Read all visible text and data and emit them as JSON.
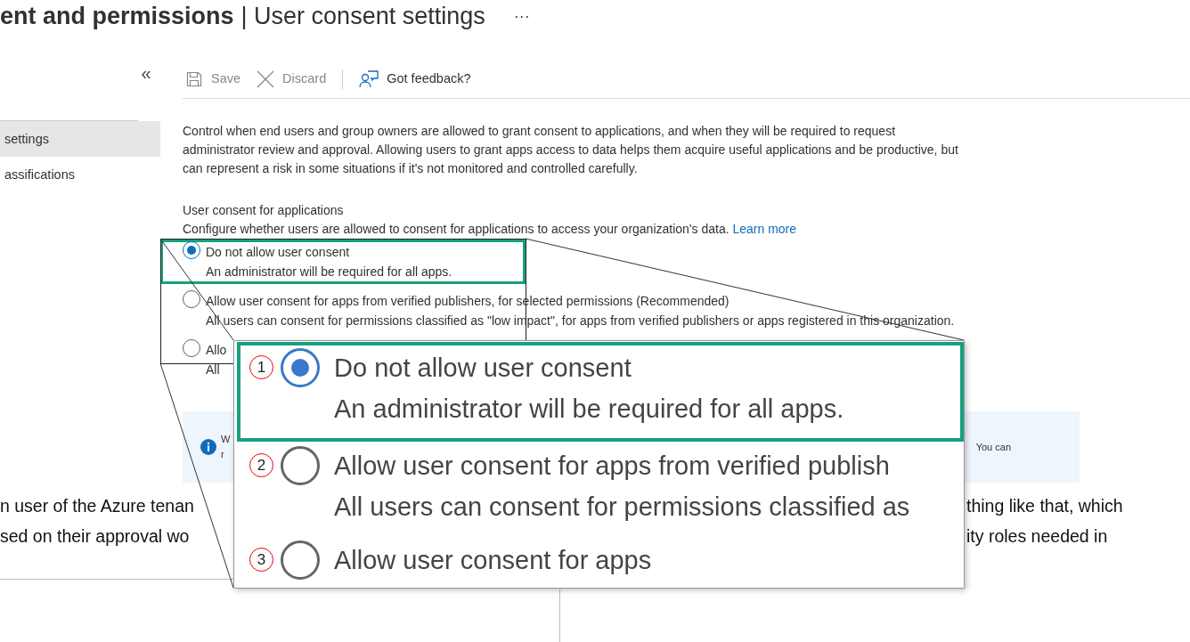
{
  "header": {
    "title_bold": "ent and permissions",
    "title_rest": "| User consent settings",
    "more": "···"
  },
  "sidebar": {
    "collapse": "«",
    "items": [
      {
        "label": "settings",
        "selected": true
      },
      {
        "label": "assifications",
        "selected": false
      }
    ]
  },
  "toolbar": [
    {
      "kind": "save",
      "label": "Save",
      "disabled": true
    },
    {
      "kind": "discard",
      "label": "Discard",
      "disabled": true
    },
    {
      "kind": "feedback",
      "label": "Got feedback?",
      "disabled": false
    }
  ],
  "description": "Control when end users and group owners are allowed to grant consent to applications, and when they will be required to request\nadministrator review and approval. Allowing users to grant apps access to data helps them acquire useful applications and be productive, but\ncan represent a risk in some situations if it's not monitored and controlled carefully.",
  "section": {
    "title": "User consent for applications",
    "hint": "Configure whether users are allowed to consent for applications to access your organization's data.",
    "link": "Learn more"
  },
  "options": [
    {
      "label": "Do not allow user consent",
      "description": "An administrator will be required for all apps.",
      "selected": true,
      "highlighted": true
    },
    {
      "label": "Allow user consent for apps from verified publishers, for selected permissions (Recommended)",
      "description": "All users can consent for permissions classified as \"low impact\", for apps from verified publishers or apps registered in this organization.",
      "selected": false
    },
    {
      "label": "Allo",
      "description": "All",
      "selected": false
    }
  ],
  "info": {
    "fragments": [
      "W",
      "r"
    ],
    "right_text": "You can"
  },
  "document_lines": [
    {
      "left": "n user of the Azure tenan",
      "right": "thing like that, which"
    },
    {
      "left": "sed on their approval wo",
      "right": "ity roles needed in"
    }
  ],
  "callout": {
    "items": [
      {
        "number": "1",
        "label": "Do not allow user consent",
        "description": "An administrator will be required for all apps.",
        "selected": true,
        "highlighted": true
      },
      {
        "number": "2",
        "label": "Allow user consent for apps from verified publish",
        "description": "All users can consent for permissions classified as",
        "selected": false
      },
      {
        "number": "3",
        "label": "Allow user consent for apps",
        "selected": false
      }
    ]
  }
}
